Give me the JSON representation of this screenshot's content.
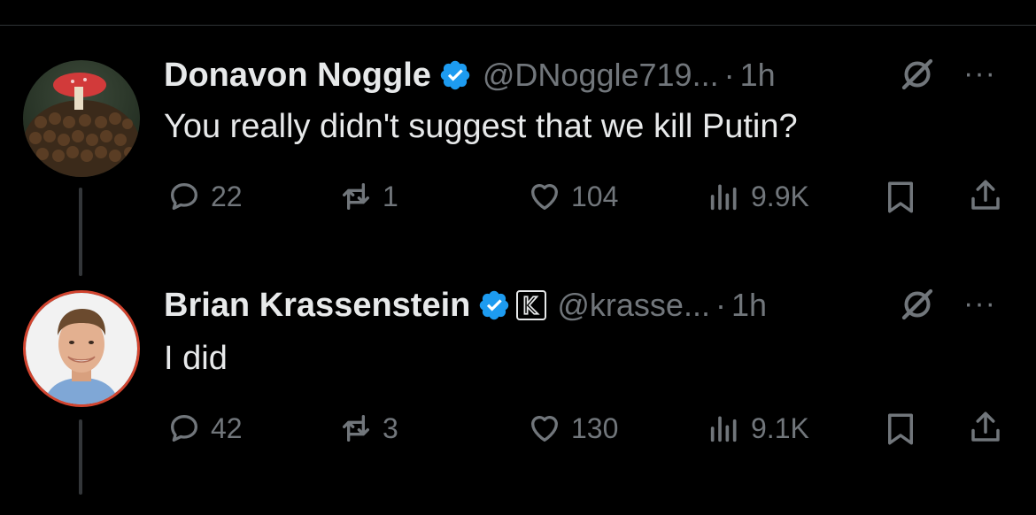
{
  "tweets": [
    {
      "name": "Donavon Noggle",
      "handle": "@DNoggle719...",
      "separator": "·",
      "time": "1h",
      "text": "You really didn't suggest that we kill Putin?",
      "avatar": "mushroom-avatar",
      "replies": "22",
      "reposts": "1",
      "likes": "104",
      "views": "9.9K"
    },
    {
      "name": "Brian Krassenstein",
      "handle": "@krasse...",
      "separator": "·",
      "time": "1h",
      "text": "I did",
      "avatar": "profile-photo-avatar",
      "affiliate_badge": "K",
      "replies": "42",
      "reposts": "3",
      "likes": "130",
      "views": "9.1K"
    }
  ],
  "more_label": "···",
  "colors": {
    "background": "#000000",
    "text": "#e7e9ea",
    "muted": "#71767b",
    "verified": "#1d9bf0"
  },
  "icons": [
    "verified-badge-icon",
    "grok-icon",
    "more-icon",
    "reply-icon",
    "repost-icon",
    "like-icon",
    "views-icon",
    "bookmark-icon",
    "share-icon"
  ]
}
